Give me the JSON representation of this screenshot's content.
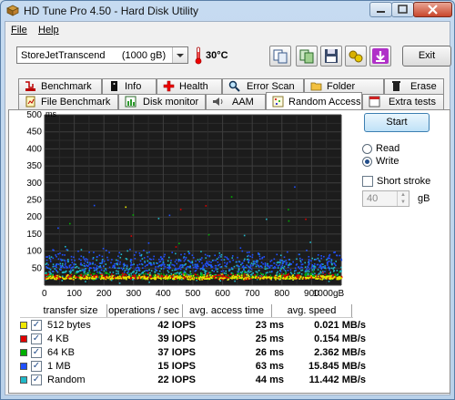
{
  "window": {
    "title": "HD Tune Pro 4.50 - Hard Disk Utility"
  },
  "menu": {
    "file": "File",
    "help": "Help"
  },
  "toolbar": {
    "drive": "StoreJetTranscend      (1000 gB)",
    "temperature": "30°C",
    "exit_label": "Exit",
    "icons": [
      "copy-text-icon",
      "copy-screenshot-icon",
      "save-icon",
      "options-icon",
      "download-icon"
    ]
  },
  "tabs": {
    "row1": [
      "Benchmark",
      "Info",
      "Health",
      "Error Scan",
      "Folder Usage",
      "Erase"
    ],
    "row2": [
      "File Benchmark",
      "Disk monitor",
      "AAM",
      "Random Access",
      "Extra tests"
    ],
    "active": "Random Access"
  },
  "controls": {
    "start_label": "Start",
    "read_label": "Read",
    "write_label": "Write",
    "mode": "Write",
    "short_stroke_label": "Short stroke",
    "short_stroke_checked": false,
    "stroke_value": "40",
    "stroke_unit": "gB"
  },
  "chart_data": {
    "type": "scatter",
    "ylabel": "ms",
    "y_ticks": [
      "500",
      "450",
      "400",
      "350",
      "300",
      "250",
      "200",
      "150",
      "100",
      "50"
    ],
    "x_ticks": [
      "0",
      "100",
      "200",
      "300",
      "400",
      "500",
      "600",
      "700",
      "800",
      "900",
      "1000gB"
    ],
    "xlim": [
      0,
      1000
    ],
    "ylim": [
      0,
      500
    ],
    "grid": true,
    "background": "#1c1c1c",
    "series": [
      {
        "name": "512 bytes",
        "color": "#e8e800",
        "center": 23,
        "spread": 6
      },
      {
        "name": "4 KB",
        "color": "#e00000",
        "center": 25,
        "spread": 7
      },
      {
        "name": "64 KB",
        "color": "#00b000",
        "center": 26,
        "spread": 9
      },
      {
        "name": "1 MB",
        "color": "#2050ff",
        "center": 63,
        "spread": 20
      },
      {
        "name": "Random",
        "color": "#20b8c8",
        "center": 44,
        "spread": 25
      }
    ]
  },
  "results": {
    "headers": [
      "transfer size",
      "operations / sec",
      "avg. access time",
      "avg. speed"
    ],
    "rows": [
      {
        "size": "512 bytes",
        "ops": "42 IOPS",
        "time": "23 ms",
        "speed": "0.021 MB/s",
        "color": "#f0e800"
      },
      {
        "size": "4 KB",
        "ops": "39 IOPS",
        "time": "25 ms",
        "speed": "0.154 MB/s",
        "color": "#e00000"
      },
      {
        "size": "64 KB",
        "ops": "37 IOPS",
        "time": "26 ms",
        "speed": "2.362 MB/s",
        "color": "#00b000"
      },
      {
        "size": "1 MB",
        "ops": "15 IOPS",
        "time": "63 ms",
        "speed": "15.845 MB/s",
        "color": "#2050ff"
      },
      {
        "size": "Random",
        "ops": "22 IOPS",
        "time": "44 ms",
        "speed": "11.442 MB/s",
        "color": "#20b8c8"
      }
    ]
  }
}
